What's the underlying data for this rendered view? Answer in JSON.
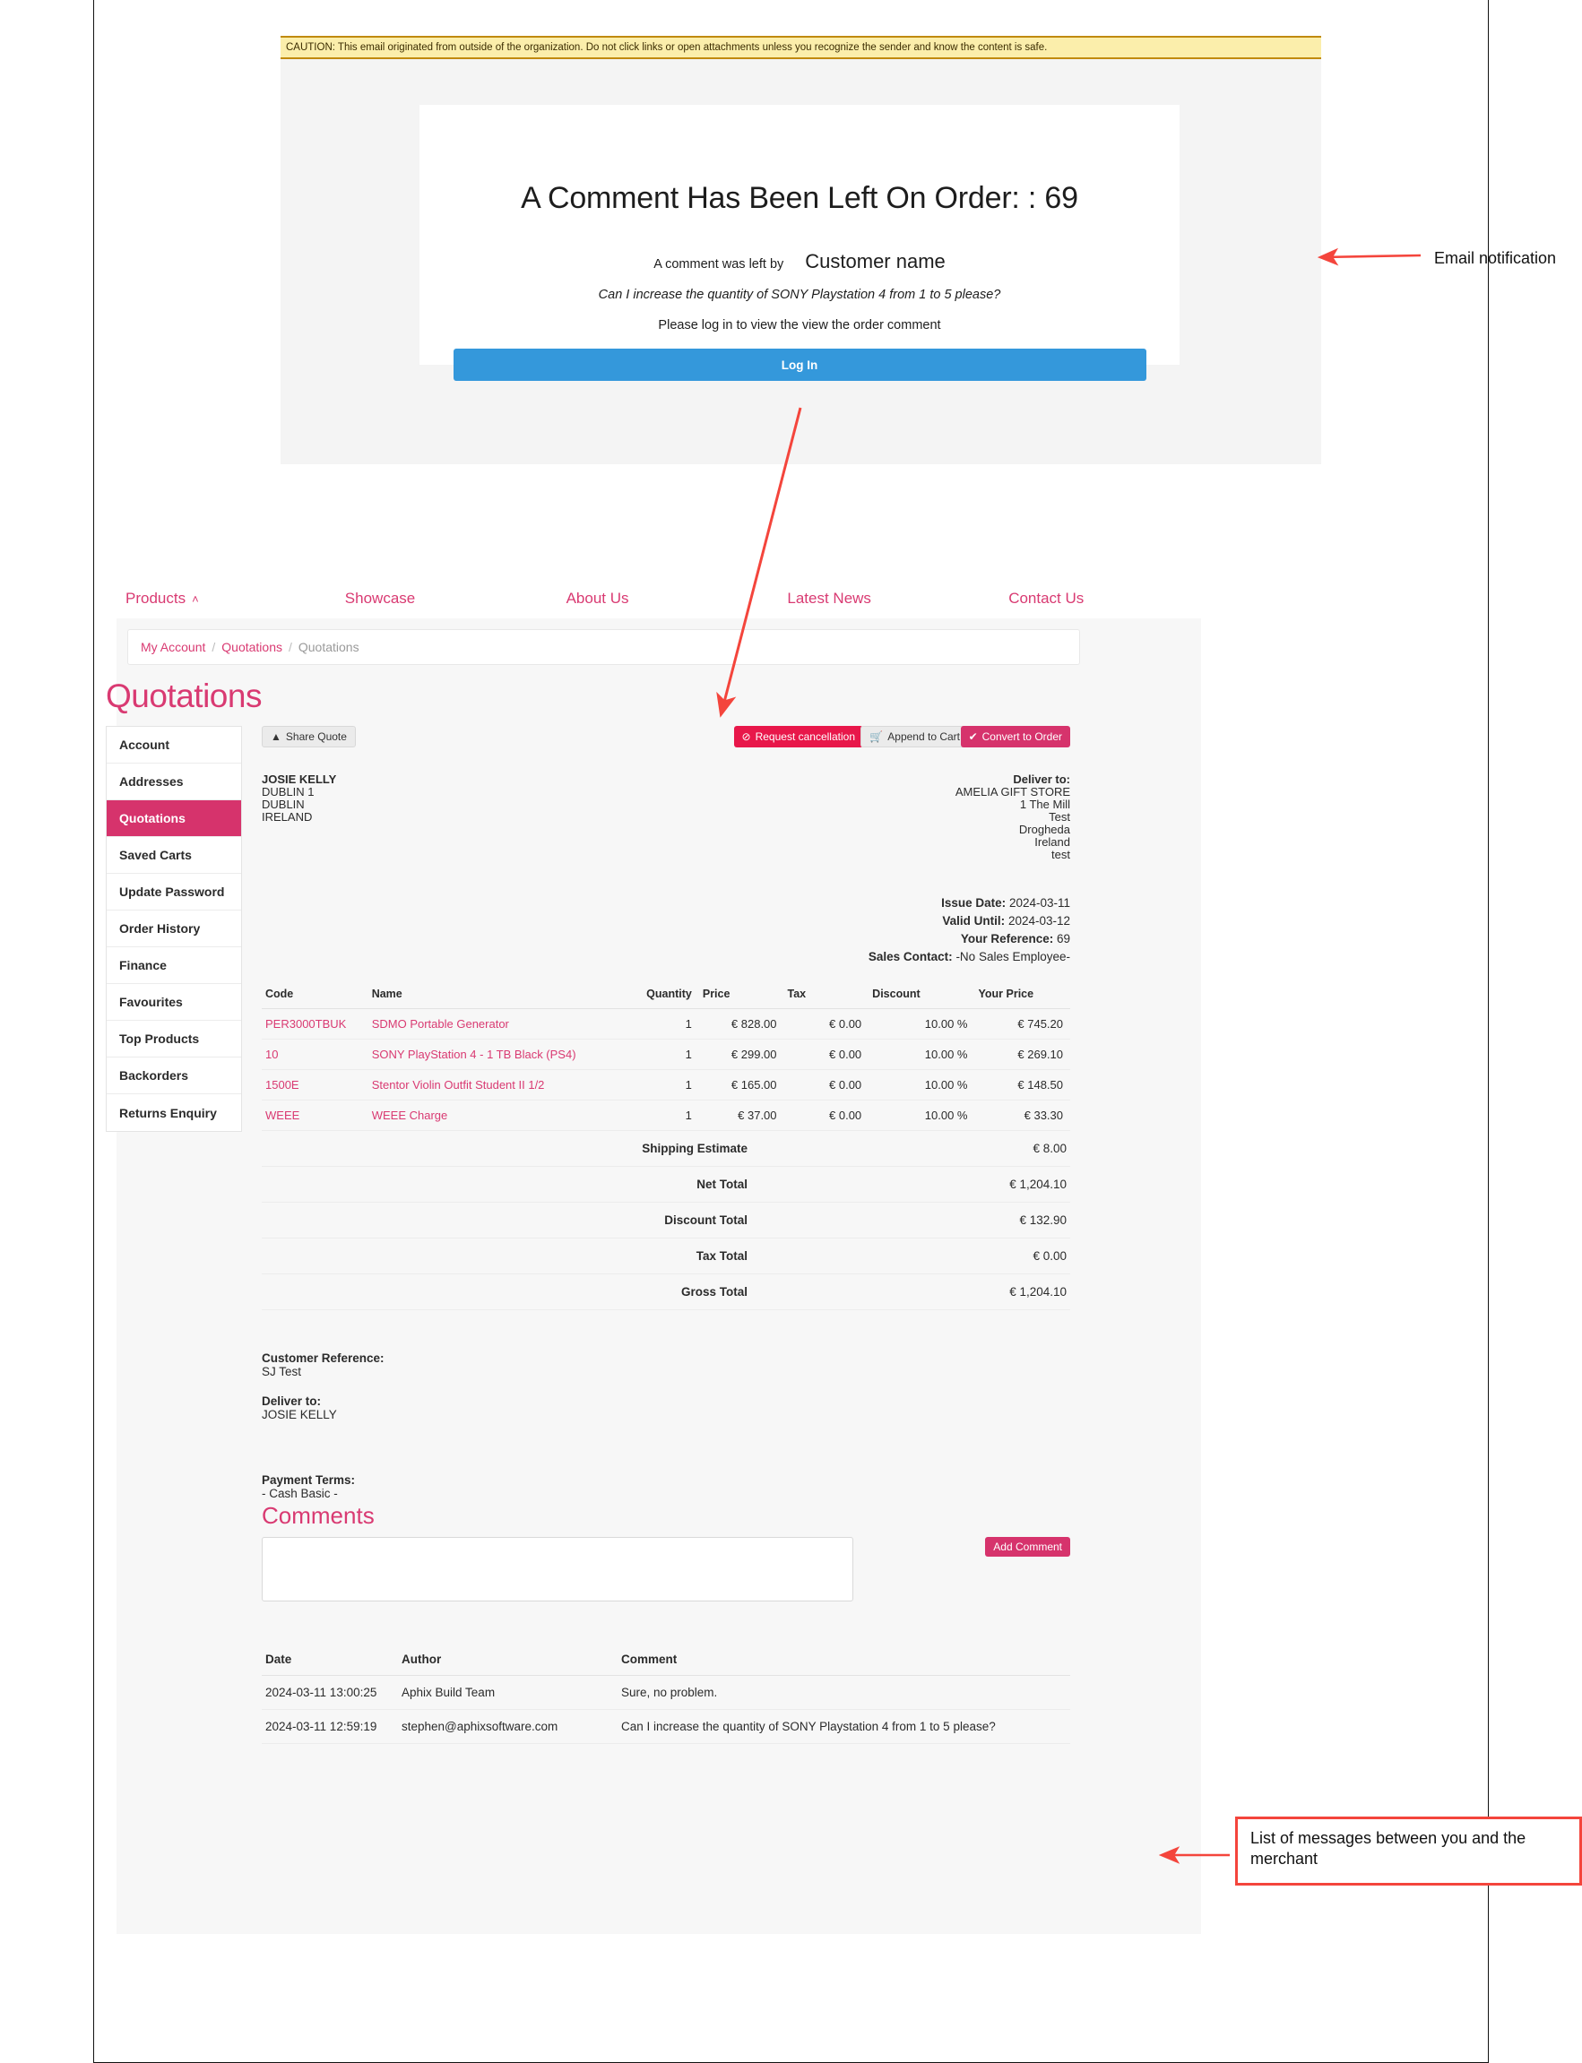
{
  "email": {
    "caution": "CAUTION: This email originated from outside of the organization. Do not click links or open attachments unless you recognize the sender and know the content is safe.",
    "title": "A Comment Has Been Left On Order: : 69",
    "byline_prefix": "A comment was left by",
    "byline_name": "Customer name",
    "comment": "Can I increase the quantity of SONY Playstation 4 from 1 to 5 please?",
    "login_hint": "Please log in to view the view the order comment",
    "login_button": "Log In"
  },
  "topnav": {
    "items": [
      {
        "label": "Products",
        "caret": "˄"
      },
      {
        "label": "Showcase",
        "caret": ""
      },
      {
        "label": "About Us",
        "caret": ""
      },
      {
        "label": "Latest News",
        "caret": ""
      },
      {
        "label": "Contact Us",
        "caret": ""
      }
    ]
  },
  "breadcrumb": {
    "items": [
      "My Account",
      "Quotations"
    ],
    "current": "Quotations",
    "separator": "/"
  },
  "page": {
    "title": "Quotations"
  },
  "sidebar": {
    "items": [
      {
        "label": "Account",
        "active": false
      },
      {
        "label": "Addresses",
        "active": false
      },
      {
        "label": "Quotations",
        "active": true
      },
      {
        "label": "Saved Carts",
        "active": false
      },
      {
        "label": "Update Password",
        "active": false
      },
      {
        "label": "Order History",
        "active": false
      },
      {
        "label": "Finance",
        "active": false
      },
      {
        "label": "Favourites",
        "active": false
      },
      {
        "label": "Top Products",
        "active": false
      },
      {
        "label": "Backorders",
        "active": false
      },
      {
        "label": "Returns Enquiry",
        "active": false
      }
    ]
  },
  "actions": {
    "share_quote": "Share Quote",
    "share_icon": "paper-plane-icon",
    "request_cancellation": "Request cancellation",
    "cancel_icon": "ban-icon",
    "append_to_cart": "Append to Cart",
    "cart_icon": "cart-icon",
    "convert_to_order": "Convert to Order",
    "check_icon": "check-icon"
  },
  "billing_address": {
    "name": "JOSIE KELLY",
    "lines": [
      "DUBLIN 1",
      "DUBLIN",
      "IRELAND"
    ]
  },
  "delivery_address": {
    "label": "Deliver to:",
    "lines": [
      "AMELIA GIFT STORE",
      "1 The Mill",
      "Test",
      "Drogheda",
      "Ireland",
      "test"
    ]
  },
  "meta": [
    {
      "label": "Issue Date:",
      "value": "2024-03-11"
    },
    {
      "label": "Valid Until:",
      "value": "2024-03-12"
    },
    {
      "label": "Your Reference:",
      "value": "69"
    },
    {
      "label": "Sales Contact:",
      "value": "-No Sales Employee-"
    }
  ],
  "items": {
    "headers": [
      "Code",
      "Name",
      "Quantity",
      "Price",
      "Tax",
      "Discount",
      "Your Price"
    ],
    "rows": [
      {
        "code": "PER3000TBUK",
        "name": "SDMO Portable Generator",
        "qty": "1",
        "price": "€ 828.00",
        "tax": "€ 0.00",
        "discount": "10.00 %",
        "your_price": "€ 745.20"
      },
      {
        "code": "10",
        "name": "SONY PlayStation 4 - 1 TB Black (PS4)",
        "qty": "1",
        "price": "€ 299.00",
        "tax": "€ 0.00",
        "discount": "10.00 %",
        "your_price": "€ 269.10"
      },
      {
        "code": "1500E",
        "name": "Stentor Violin Outfit Student II 1/2",
        "qty": "1",
        "price": "€ 165.00",
        "tax": "€ 0.00",
        "discount": "10.00 %",
        "your_price": "€ 148.50"
      },
      {
        "code": "WEEE",
        "name": "WEEE Charge",
        "qty": "1",
        "price": "€ 37.00",
        "tax": "€ 0.00",
        "discount": "10.00 %",
        "your_price": "€ 33.30"
      }
    ]
  },
  "totals": [
    {
      "label": "Shipping Estimate",
      "value": "€ 8.00"
    },
    {
      "label": "Net Total",
      "value": "€ 1,204.10"
    },
    {
      "label": "Discount Total",
      "value": "€ 132.90"
    },
    {
      "label": "Tax Total",
      "value": "€ 0.00"
    },
    {
      "label": "Gross Total",
      "value": "€ 1,204.10"
    }
  ],
  "references": {
    "customer_reference_label": "Customer Reference:",
    "customer_reference_value": "SJ Test",
    "deliver_to_label": "Deliver to:",
    "deliver_to_value": "JOSIE KELLY",
    "payment_terms_label": "Payment Terms:",
    "payment_terms_value": "- Cash Basic -"
  },
  "comments": {
    "heading": "Comments",
    "textarea_value": "",
    "textarea_placeholder": "",
    "add_button": "Add Comment",
    "headers": [
      "Date",
      "Author",
      "Comment"
    ],
    "rows": [
      {
        "date": "2024-03-11 13:00:25",
        "author": "Aphix Build Team",
        "comment": "Sure, no problem."
      },
      {
        "date": "2024-03-11 12:59:19",
        "author": "stephen@aphixsoftware.com",
        "comment": "Can I increase the quantity of SONY Playstation 4 from 1 to 5 please?"
      }
    ]
  },
  "annotations": {
    "email_note": "Email notification",
    "messages_note": "List of messages between you and the merchant",
    "arrow_color": "#f4453c"
  },
  "colors": {
    "brand_pink": "#d6336c",
    "link_pink": "#d93a72",
    "danger_red": "#e8174a",
    "login_blue": "#3498db",
    "caution_yellow": "#fbeeab"
  }
}
